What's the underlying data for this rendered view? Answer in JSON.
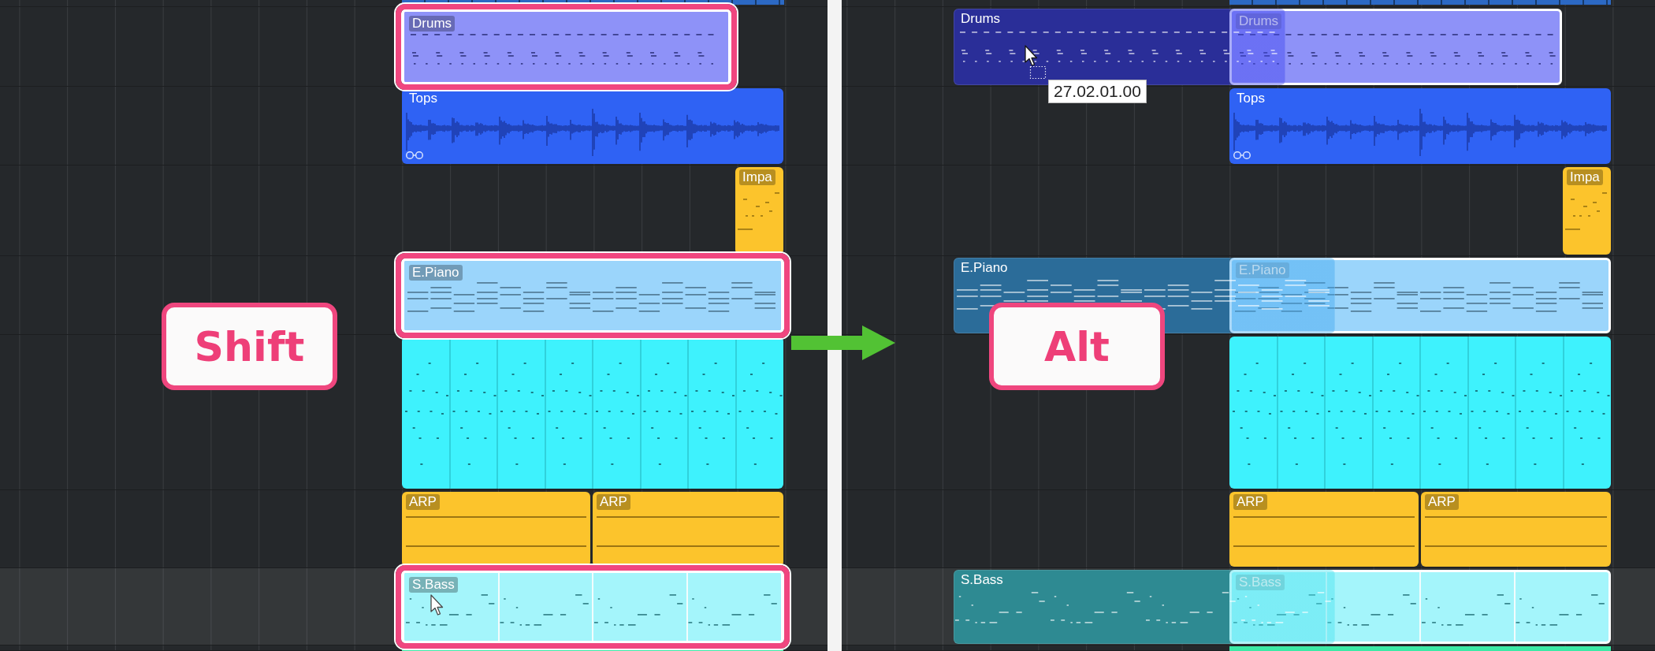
{
  "panels": [
    {
      "key_label": "Shift",
      "highlight_selected": true,
      "copying": false,
      "tracks": [
        {
          "selected": false,
          "regions": [
            {
              "kind": "strip",
              "color": "#2c69c4"
            }
          ]
        },
        {
          "selected": false,
          "regions": [
            {
              "kind": "drums",
              "label": "Drums",
              "color": "#8e92f8",
              "selected": true
            }
          ]
        },
        {
          "selected": false,
          "regions": [
            {
              "kind": "audio",
              "label": "Tops",
              "color": "#2f62f4",
              "selected": false
            }
          ]
        },
        {
          "selected": false,
          "regions": [
            {
              "kind": "riser",
              "label": "Impa",
              "color": "#fcc42c",
              "selected": false
            }
          ]
        },
        {
          "selected": false,
          "regions": [
            {
              "kind": "chords",
              "label": "E.Piano",
              "color": "#9bd5fb",
              "selected": true
            }
          ]
        },
        {
          "selected": false,
          "regions": [
            {
              "kind": "loop",
              "color": "#3ef2fd",
              "selected": false
            }
          ]
        },
        {
          "selected": false,
          "regions": [
            {
              "kind": "arp",
              "label": "ARP",
              "color": "#fcc42c",
              "selected": false
            },
            {
              "kind": "arp",
              "label": "ARP",
              "color": "#fcc42c",
              "selected": false
            }
          ]
        },
        {
          "selected": true,
          "regions": [
            {
              "kind": "bass",
              "label": "S.Bass",
              "color": "#a4f5fb",
              "selected": true
            }
          ]
        },
        {
          "selected": false,
          "regions": [
            {
              "kind": "strip",
              "color": "#3ce9a6"
            }
          ]
        }
      ]
    },
    {
      "key_label": "Alt",
      "highlight_selected": false,
      "copying": true,
      "tooltip": "27.02.01.00",
      "tracks": [
        {
          "selected": false,
          "regions": [
            {
              "kind": "strip",
              "color": "#2c69c4"
            }
          ]
        },
        {
          "selected": false,
          "drag_copies": [
            {
              "kind": "drums",
              "label": "Drums",
              "color": "#2a2e98"
            }
          ],
          "regions": [
            {
              "kind": "drums",
              "label": "Drums",
              "color": "#8e92f8",
              "selected": true
            }
          ]
        },
        {
          "selected": false,
          "regions": [
            {
              "kind": "audio",
              "label": "Tops",
              "color": "#2f62f4",
              "selected": false
            }
          ]
        },
        {
          "selected": false,
          "regions": [
            {
              "kind": "riser",
              "label": "Impa",
              "color": "#fcc42c",
              "selected": false
            }
          ]
        },
        {
          "selected": false,
          "drag_copies": [
            {
              "kind": "chords",
              "label": "E.Piano",
              "color": "#2b6c99"
            }
          ],
          "regions": [
            {
              "kind": "chords",
              "label": "E.Piano",
              "color": "#9bd5fb",
              "selected": true
            }
          ]
        },
        {
          "selected": false,
          "regions": [
            {
              "kind": "loop",
              "color": "#3ef2fd",
              "selected": false
            }
          ]
        },
        {
          "selected": false,
          "regions": [
            {
              "kind": "arp",
              "label": "ARP",
              "color": "#fcc42c",
              "selected": false
            },
            {
              "kind": "arp",
              "label": "ARP",
              "color": "#fcc42c",
              "selected": false
            }
          ]
        },
        {
          "selected": true,
          "drag_copies": [
            {
              "kind": "bass",
              "label": "S.Bass",
              "color": "#2e8a92"
            }
          ],
          "regions": [
            {
              "kind": "bass",
              "label": "S.Bass",
              "color": "#a4f5fb",
              "selected": true
            }
          ]
        },
        {
          "selected": false,
          "regions": [
            {
              "kind": "strip",
              "color": "#3ce9a6"
            }
          ]
        }
      ]
    }
  ]
}
